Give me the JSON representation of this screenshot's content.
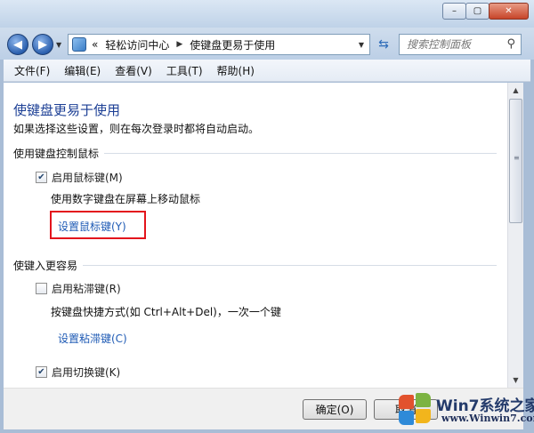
{
  "window": {
    "caption_buttons": {
      "minimize": "–",
      "maximize": "▢",
      "close": "✕"
    }
  },
  "nav": {
    "back_glyph": "◀",
    "forward_glyph": "▶",
    "address_prefix": "«",
    "breadcrumbs": [
      "轻松访问中心",
      "使键盘更易于使用"
    ],
    "search_placeholder": "搜索控制面板"
  },
  "menu": [
    "文件(F)",
    "编辑(E)",
    "查看(V)",
    "工具(T)",
    "帮助(H)"
  ],
  "page": {
    "title": "使键盘更易于使用",
    "subtitle": "如果选择这些设置，则在每次登录时都将自动启动。",
    "section_mouse": {
      "heading": "使用键盘控制鼠标",
      "checkbox_label": "启用鼠标键(M)",
      "checked": true,
      "description": "使用数字键盘在屏幕上移动鼠标",
      "link": "设置鼠标键(Y)"
    },
    "section_typing": {
      "heading": "使键入更容易",
      "sticky_label": "启用粘滞键(R)",
      "sticky_checked": false,
      "sticky_description": "按键盘快捷方式(如 Ctrl+Alt+Del)，一次一个键",
      "sticky_link": "设置粘滞键(C)",
      "toggle_label": "启用切换键(K)",
      "toggle_checked": true
    }
  },
  "buttons": {
    "ok": "确定(O)",
    "cancel": "取消"
  },
  "watermark": {
    "name": "系统之家",
    "brand": "Win7",
    "url": "www.Winwin7.com"
  },
  "colors": {
    "title": "#1c3f95",
    "link": "#1f5bb5",
    "highlight_box": "#e3141c"
  }
}
